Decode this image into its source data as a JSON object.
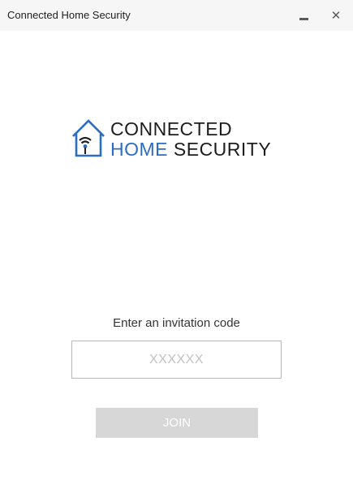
{
  "window": {
    "title": "Connected Home Security",
    "minimize_icon": "minimize-icon",
    "close_icon": "close-icon",
    "close_glyph": "✕"
  },
  "logo": {
    "line1": "CONNECTED",
    "line2_accent": "HOME",
    "line2_rest": "SECURITY",
    "icon": "house-wifi-icon",
    "accent_color": "#2b6cc4"
  },
  "invite": {
    "prompt": "Enter an invitation code",
    "code_placeholder": "XXXXXX",
    "code_value": ""
  },
  "actions": {
    "join_label": "JOIN",
    "join_enabled": false,
    "join_color": "#d7d7d7"
  }
}
